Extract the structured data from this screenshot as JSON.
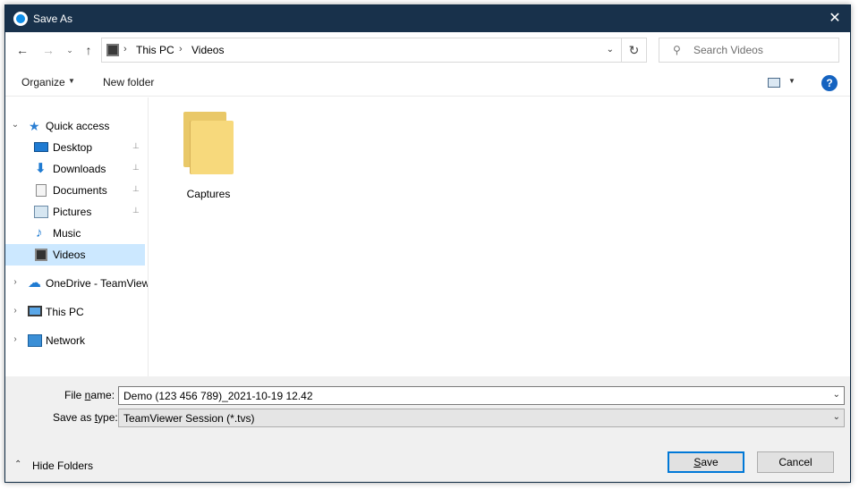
{
  "window": {
    "title": "Save As",
    "close_label": "✕",
    "accent_color": "#18314b"
  },
  "navigation": {
    "back_label": "←",
    "forward_label": "→",
    "recent_label": "⌄",
    "up_label": "↑"
  },
  "address": {
    "breadcrumbs": [
      "This PC",
      "Videos"
    ],
    "separator": "›",
    "dropdown_label": "⌄",
    "refresh_label": "↻"
  },
  "search": {
    "placeholder": "Search Videos",
    "icon": "search-icon"
  },
  "toolbar": {
    "organize_label": "Organize",
    "organize_caret": "▼",
    "new_folder_label": "New folder",
    "view_caret": "▼",
    "help_label": "?"
  },
  "sidebar": {
    "items": [
      {
        "label": "Quick access",
        "icon": "star-icon",
        "expander": "⌄",
        "pinned": false
      },
      {
        "label": "Desktop",
        "icon": "desktop-icon",
        "pinned": true
      },
      {
        "label": "Downloads",
        "icon": "download-icon",
        "pinned": true
      },
      {
        "label": "Documents",
        "icon": "document-icon",
        "pinned": true
      },
      {
        "label": "Pictures",
        "icon": "pictures-icon",
        "pinned": true
      },
      {
        "label": "Music",
        "icon": "music-icon",
        "pinned": false
      },
      {
        "label": "Videos",
        "icon": "videos-icon",
        "pinned": false,
        "selected": true
      },
      {
        "label": "OneDrive - TeamViewer",
        "icon": "onedrive-icon",
        "expander": "›"
      },
      {
        "label": "This PC",
        "icon": "this-pc-icon",
        "expander": "›"
      },
      {
        "label": "Network",
        "icon": "network-icon",
        "expander": "›"
      }
    ],
    "pin_glyph": "📌"
  },
  "content": {
    "folders": [
      {
        "name": "Captures",
        "icon": "folder-icon"
      }
    ]
  },
  "form": {
    "file_name_label_prefix": "File ",
    "file_name_label_ul": "n",
    "file_name_label_suffix": "ame:",
    "file_name_value": "Demo (123 456 789)_2021-10-19 12.42",
    "save_type_label_prefix": "Save as ",
    "save_type_label_ul": "t",
    "save_type_label_suffix": "ype:",
    "save_type_value": "TeamViewer Session (*.tvs)",
    "dropdown_label": "⌄"
  },
  "footer": {
    "hide_folders_label": "Hide Folders",
    "hide_folders_chevron": "⌃",
    "save_label_ul": "S",
    "save_label_rest": "ave",
    "cancel_label": "Cancel"
  }
}
